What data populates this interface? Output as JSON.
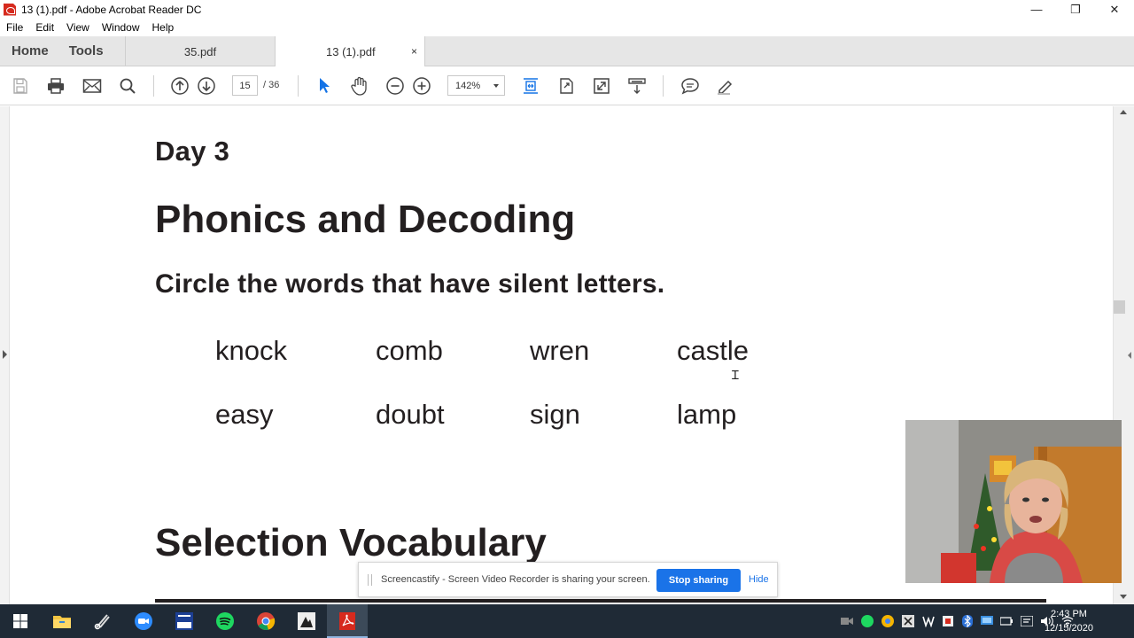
{
  "window": {
    "title": "13 (1).pdf - Adobe Acrobat Reader DC",
    "controls": {
      "minimize": "—",
      "restore": "❐",
      "close": "✕"
    }
  },
  "menu": [
    "File",
    "Edit",
    "View",
    "Window",
    "Help"
  ],
  "tabs": {
    "home": "Home",
    "tools": "Tools",
    "documents": [
      {
        "label": "35.pdf",
        "active": false
      },
      {
        "label": "13 (1).pdf",
        "active": true,
        "close": "×"
      }
    ]
  },
  "toolbar": {
    "page_current": "15",
    "page_total": "/  36",
    "zoom": "142%",
    "icons": [
      "save-icon",
      "print-icon",
      "email-icon",
      "search-icon",
      "previous-page-icon",
      "next-page-icon",
      "select-cursor-icon",
      "hand-tool-icon",
      "zoom-out-icon",
      "zoom-in-icon",
      "fit-page-icon",
      "fullscreen-icon",
      "scroll-mode-icon",
      "read-mode-icon",
      "comment-icon",
      "highlight-pen-icon"
    ]
  },
  "document": {
    "day": "Day 3",
    "heading": "Phonics and Decoding",
    "instruction": "Circle the words that have silent letters.",
    "words_row1": [
      "knock",
      "comb",
      "wren",
      "castle"
    ],
    "words_row2": [
      "easy",
      "doubt",
      "sign",
      "lamp"
    ],
    "next_heading": "Selection Vocabulary"
  },
  "share_bar": {
    "message": "Screencastify - Screen Video Recorder is sharing your screen.",
    "stop_label": "Stop sharing",
    "hide_label": "Hide"
  },
  "taskbar": {
    "apps": [
      "start-icon",
      "file-explorer-icon",
      "snipping-tool-icon",
      "zoom-icon",
      "teacher-app-icon",
      "spotify-icon",
      "chrome-icon",
      "music-app-icon",
      "acrobat-icon"
    ],
    "time": "2:43 PM",
    "date": "12/15/2020"
  },
  "colors": {
    "taskbar_bg": "#1f2a36",
    "accent_blue": "#1a73e8",
    "acrobat_red": "#d62a1e",
    "text_dark": "#231f20"
  }
}
